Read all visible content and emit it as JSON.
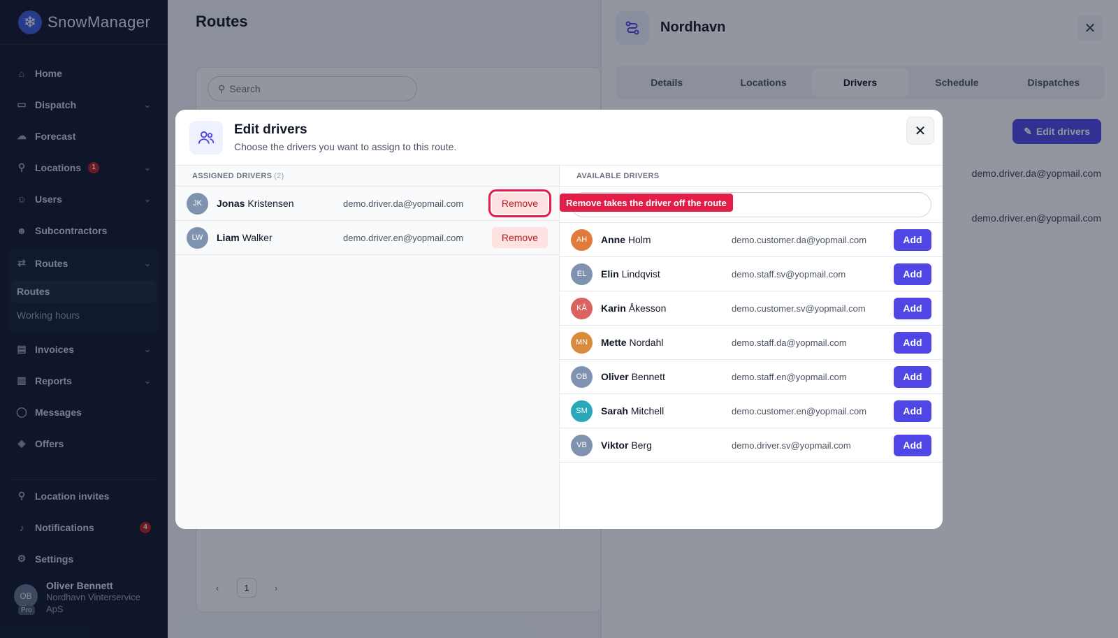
{
  "app": {
    "name": "SnowManager"
  },
  "sidebar": {
    "items": [
      {
        "label": "Home"
      },
      {
        "label": "Dispatch"
      },
      {
        "label": "Forecast"
      },
      {
        "label": "Locations",
        "badge": "1"
      },
      {
        "label": "Users"
      },
      {
        "label": "Subcontractors"
      },
      {
        "label": "Routes"
      },
      {
        "label": "Invoices"
      },
      {
        "label": "Reports"
      },
      {
        "label": "Messages"
      },
      {
        "label": "Offers"
      }
    ],
    "routes_sub": [
      {
        "label": "Routes"
      },
      {
        "label": "Working hours"
      }
    ],
    "bottom": [
      {
        "label": "Location invites"
      },
      {
        "label": "Notifications",
        "badge": "4"
      },
      {
        "label": "Settings"
      }
    ],
    "user": {
      "initials": "OB",
      "tag": "Pro",
      "name": "Oliver Bennett",
      "org": "Nordhavn Vinterservice ApS"
    }
  },
  "main": {
    "title": "Routes",
    "search_placeholder": "Search",
    "pager": {
      "prev": "‹",
      "page": "1",
      "next": "›"
    }
  },
  "panel": {
    "title": "Nordhavn",
    "close": "✕",
    "tabs": [
      {
        "label": "Details"
      },
      {
        "label": "Locations"
      },
      {
        "label": "Drivers"
      },
      {
        "label": "Schedule"
      },
      {
        "label": "Dispatches"
      }
    ],
    "edit_label": "Edit drivers",
    "emails": [
      "demo.driver.da@yopmail.com",
      "demo.driver.en@yopmail.com"
    ]
  },
  "modal": {
    "title": "Edit drivers",
    "subtitle": "Choose the drivers you want to assign to this route.",
    "close": "✕",
    "assigned_header": "ASSIGNED DRIVERS",
    "assigned_count": "(2)",
    "available_header": "AVAILABLE DRIVERS",
    "remove_label": "Remove",
    "add_label": "Add",
    "tooltip": "Remove takes the driver off the route",
    "assigned": [
      {
        "initials": "JK",
        "first": "Jonas",
        "last": "Kristensen",
        "email": "demo.driver.da@yopmail.com",
        "color": "#7f93b0"
      },
      {
        "initials": "LW",
        "first": "Liam",
        "last": "Walker",
        "email": "demo.driver.en@yopmail.com",
        "color": "#7f93b0"
      }
    ],
    "available": [
      {
        "initials": "AH",
        "first": "Anne",
        "last": "Holm",
        "email": "demo.customer.da@yopmail.com",
        "color": "#e07b3c"
      },
      {
        "initials": "EL",
        "first": "Elin",
        "last": "Lindqvist",
        "email": "demo.staff.sv@yopmail.com",
        "color": "#7f93b0"
      },
      {
        "initials": "KÅ",
        "first": "Karin",
        "last": "Åkesson",
        "email": "demo.customer.sv@yopmail.com",
        "color": "#d9645f"
      },
      {
        "initials": "MN",
        "first": "Mette",
        "last": "Nordahl",
        "email": "demo.staff.da@yopmail.com",
        "color": "#d98a3c"
      },
      {
        "initials": "OB",
        "first": "Oliver",
        "last": "Bennett",
        "email": "demo.staff.en@yopmail.com",
        "color": "#7f93b0"
      },
      {
        "initials": "SM",
        "first": "Sarah",
        "last": "Mitchell",
        "email": "demo.customer.en@yopmail.com",
        "color": "#2aa7b8"
      },
      {
        "initials": "VB",
        "first": "Viktor",
        "last": "Berg",
        "email": "demo.driver.sv@yopmail.com",
        "color": "#7f93b0"
      }
    ]
  }
}
